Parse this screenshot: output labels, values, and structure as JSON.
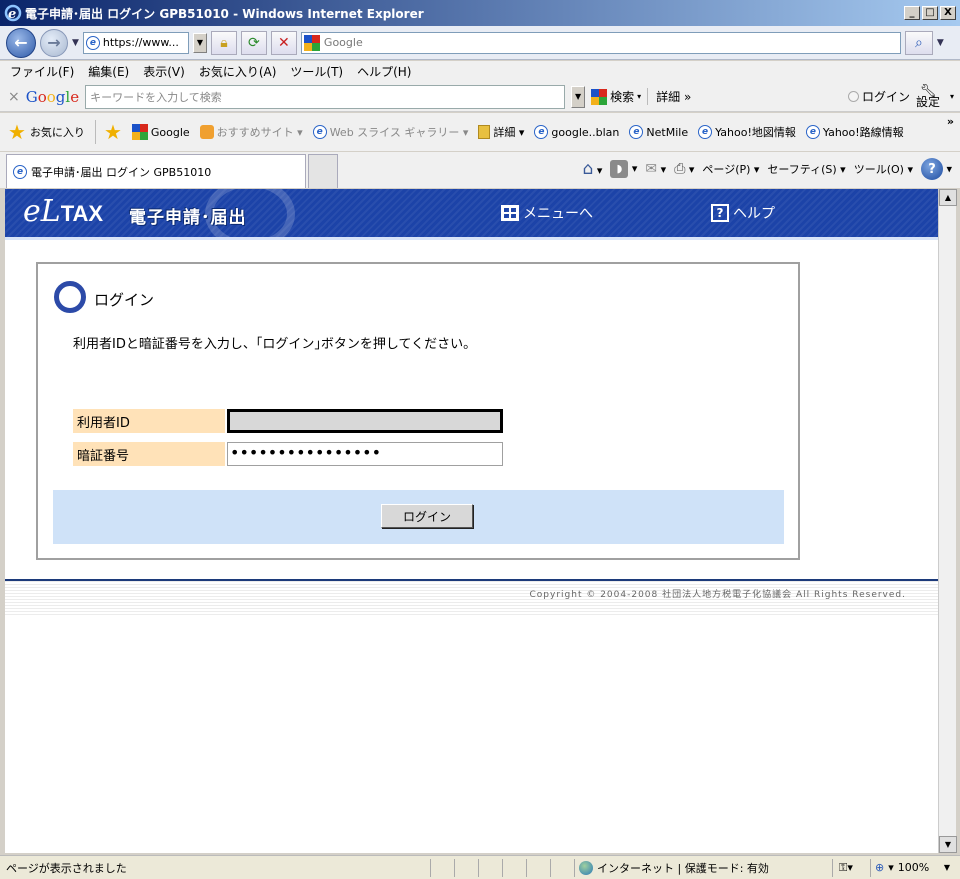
{
  "window": {
    "title": "電子申請･届出 ログイン GPB51010 - Windows Internet Explorer",
    "min": "_",
    "max": "□",
    "close": "X"
  },
  "nav": {
    "address": "https://www...",
    "search_placeholder": "Google"
  },
  "menubar": {
    "items": [
      "ファイル(F)",
      "編集(E)",
      "表示(V)",
      "お気に入り(A)",
      "ツール(T)",
      "ヘルプ(H)"
    ]
  },
  "google_toolbar": {
    "close": "×",
    "logo": [
      "G",
      "o",
      "o",
      "g",
      "l",
      "e"
    ],
    "placeholder": "キーワードを入力して検索",
    "search": "検索",
    "more": "詳細 »",
    "login": "ログイン",
    "settings": "設定"
  },
  "favorites": {
    "label": "お気に入り",
    "items": [
      "Google",
      "おすすめサイト ▾",
      "Web スライス ギャラリー ▾",
      "詳細 ▾",
      "google..blan",
      "NetMile",
      "Yahoo!地図情報",
      "Yahoo!路線情報"
    ],
    "overflow": "»"
  },
  "tab": {
    "title": "電子申請･届出 ログイン GPB51010"
  },
  "command_bar": {
    "page": "ページ(P) ▾",
    "safety": "セーフティ(S) ▾",
    "tools": "ツール(O) ▾",
    "help": "?"
  },
  "eltax": {
    "logo_el": "eL",
    "logo_tax": "TAX",
    "subtitle": "電子申請･届出",
    "menu": "メニューへ",
    "help": "ヘルプ",
    "help_q": "?"
  },
  "login_panel": {
    "title": "ログイン",
    "description": "利用者IDと暗証番号を入力し、｢ログイン｣ボタンを押してください。",
    "user_id_label": "利用者ID",
    "user_id_value": "",
    "password_label": "暗証番号",
    "password_value": "••••••••••••••••",
    "login_button": "ログイン"
  },
  "footer": {
    "copyright": "Copyright © 2004-2008 社団法人地方税電子化協議会 All Rights Reserved."
  },
  "statusbar": {
    "text": "ページが表示されました",
    "zone": "インターネット | 保護モード: 有効",
    "zoom": "100%"
  }
}
